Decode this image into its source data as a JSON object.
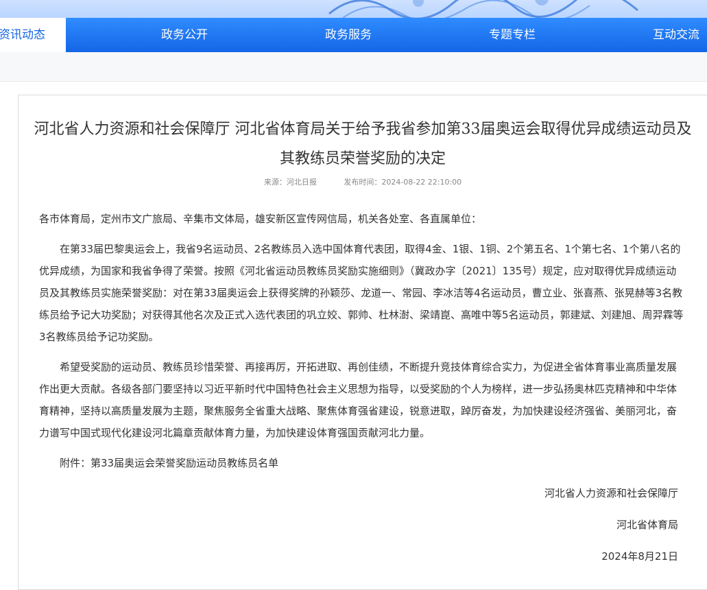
{
  "nav": {
    "items": [
      {
        "label": "资讯动态",
        "active": true
      },
      {
        "label": "政务公开"
      },
      {
        "label": "政务服务"
      },
      {
        "label": "专题专栏"
      },
      {
        "label": "互动交流"
      }
    ],
    "colors": {
      "bar": "#1565e6",
      "active_bg": "#ffffff",
      "active_text": "#1565e6"
    }
  },
  "article": {
    "title": "河北省人力资源和社会保障厅 河北省体育局关于给予我省参加第33届奥运会取得优异成绩运动员及其教练员荣誉奖励的决定",
    "source_label": "来源：河北日报",
    "time_label": "发布时间：2024-08-22 22:10:00",
    "salutation": "各市体育局，定州市文广旅局、辛集市文体局，雄安新区宣传网信局，机关各处室、各直属单位：",
    "para1": "在第33届巴黎奥运会上，我省9名运动员、2名教练员入选中国体育代表团，取得4金、1银、1铜、2个第五名、1个第七名、1个第八名的优异成绩，为国家和我省争得了荣誉。按照《河北省运动员教练员奖励实施细则》（冀政办字〔2021〕135号）规定，应对取得优异成绩运动员及其教练员实施荣誉奖励：对在第33届奥运会上获得奖牌的孙颖莎、龙道一、常园、李冰洁等4名运动员，曹立业、张喜燕、张晃赫等3名教练员给予记大功奖励；对获得其他名次及正式入选代表团的巩立姣、郭帅、杜林澍、梁靖崑、高唯中等5名运动员，郭建斌、刘建旭、周羿霖等3名教练员给予记功奖励。",
    "para2": "希望受奖励的运动员、教练员珍惜荣誉、再接再厉，开拓进取、再创佳绩，不断提升竞技体育综合实力，为促进全省体育事业高质量发展作出更大贡献。各级各部门要坚持以习近平新时代中国特色社会主义思想为指导，以受奖励的个人为榜样，进一步弘扬奥林匹克精神和中华体育精神，坚持以高质量发展为主题，聚焦服务全省重大战略、聚焦体育强省建设，锐意进取，踔厉奋发，为加快建设经济强省、美丽河北，奋力谱写中国式现代化建设河北篇章贡献体育力量，为加快建设体育强国贡献河北力量。",
    "attachment": "附件：第33届奥运会荣誉奖励运动员教练员名单",
    "signer1": "河北省人力资源和社会保障厅",
    "signer2": "河北省体育局",
    "date": "2024年8月21日"
  }
}
